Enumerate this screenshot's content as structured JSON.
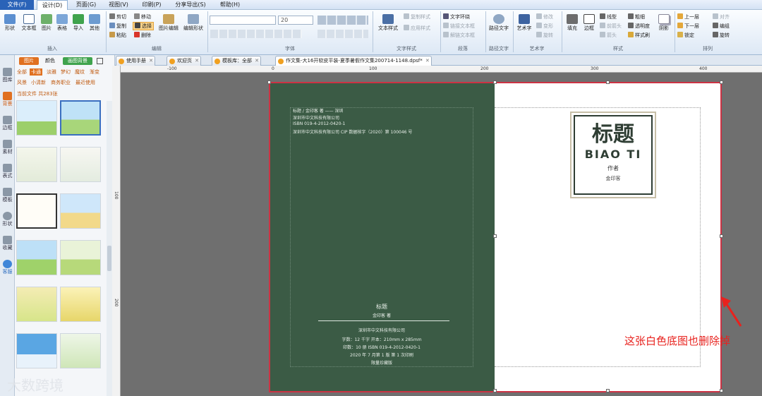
{
  "menu": {
    "items": [
      "文件(F)",
      "设计(D)",
      "页面(G)",
      "视图(V)",
      "印刷(P)",
      "分享导出(S)",
      "帮助(H)"
    ],
    "active": "设计(D)"
  },
  "ribbon": {
    "insert": {
      "label": "插入",
      "buttons": [
        "形状",
        "文本框",
        "图片",
        "表格",
        "导入",
        "其他"
      ]
    },
    "edit": {
      "label": "编辑",
      "cut": "剪切",
      "copy": "复制",
      "paste": "粘贴",
      "move": "移动",
      "select": "选择",
      "delete": "删除",
      "image_edit": "图片编辑",
      "shape_edit": "编辑形状"
    },
    "font": {
      "label": "字体",
      "font_size": "20"
    },
    "text_style": {
      "label": "文字样式",
      "main": "文本样式",
      "copy_style": "复制样式",
      "apply_style": "应用样式"
    },
    "paragraph": {
      "label": "段落",
      "wrap": "文字环绕",
      "link_frame": "链接文本框",
      "unlink_frame": "解链文本框"
    },
    "path_text": {
      "label": "路径文字",
      "main": "路径文字"
    },
    "art_text": {
      "label": "艺术字",
      "main": "艺术字",
      "modify": "修改",
      "transform": "变形",
      "rotate": "旋转"
    },
    "style": {
      "label": "样式",
      "fill": "填充",
      "border": "边框",
      "line_type": "线型",
      "front_arrow": "前箭头",
      "back_arrow": "箭头",
      "thickness": "粗细",
      "transparency": "透明度",
      "style_brush": "样式刷",
      "shadow": "阴影"
    },
    "arrange": {
      "label": "排列",
      "up": "上一层",
      "down": "下一层",
      "lock": "锁定",
      "align": "对齐",
      "group": "编组",
      "rotate": "旋转"
    }
  },
  "doc_tabs": [
    "使用手册",
    "欢迎页",
    "模板库：全部",
    "作文集-大16开软皮平装-夏季暑假作文集200714-1148.dpsf*"
  ],
  "active_tab": 3,
  "left_rail": [
    {
      "label": "图库",
      "icon": "gallery-icon"
    },
    {
      "label": "背景",
      "icon": "background-icon"
    },
    {
      "label": "边框",
      "icon": "border-icon"
    },
    {
      "label": "素材",
      "icon": "material-icon"
    },
    {
      "label": "表式",
      "icon": "table-icon"
    },
    {
      "label": "模板",
      "icon": "template-icon"
    },
    {
      "label": "形状",
      "icon": "shape-icon"
    },
    {
      "label": "收藏",
      "icon": "star-icon"
    },
    {
      "label": "客服",
      "icon": "chat-icon"
    }
  ],
  "active_rail": "背景",
  "panel": {
    "tabs": [
      "图片",
      "颜色",
      "画图背景"
    ],
    "categories_row1": [
      "全部",
      "卡通",
      "淡雅",
      "梦幻",
      "魔纹",
      "渐变"
    ],
    "categories_row2": [
      "风景",
      "小清新",
      "商务职业",
      "最近使用"
    ],
    "active_category": "卡通",
    "count": "当前文件 共283张"
  },
  "ruler": {
    "h": [
      "-100",
      "0",
      "100",
      "200",
      "300",
      "400"
    ],
    "v": [
      "100",
      "200"
    ]
  },
  "back_cover": {
    "line1": "标题 / 金印客 著 —— 深圳",
    "line2": "深圳市中文科技有限公司",
    "line3": "ISBN  019-4-2012-0420-1",
    "line4": "深圳市中文科技有限公司 CIP 数据核字（2020）第 100046 号",
    "title": "标题",
    "author": "金印客 著",
    "publisher": "深圳市中文科技有限公司",
    "spec1": "字数：12 千字    开本：210mm x 285mm",
    "spec2": "印数：10 册    ISBN   019-4-2012-0420-1",
    "spec3": "2020 年 7 月第 1 版    第 1 次印刷",
    "spec4": "限量珍藏版"
  },
  "front_cover": {
    "title": "标题",
    "title_pinyin": "BIAO TI",
    "author_label": "作者",
    "author_name": "金印客"
  },
  "annotation": "这张白色底图也删除掉",
  "watermark": "大数跨境",
  "colors": {
    "cover_green": "#3b5b45",
    "accent_orange": "#e07020",
    "annotation_red": "#e8221e"
  }
}
